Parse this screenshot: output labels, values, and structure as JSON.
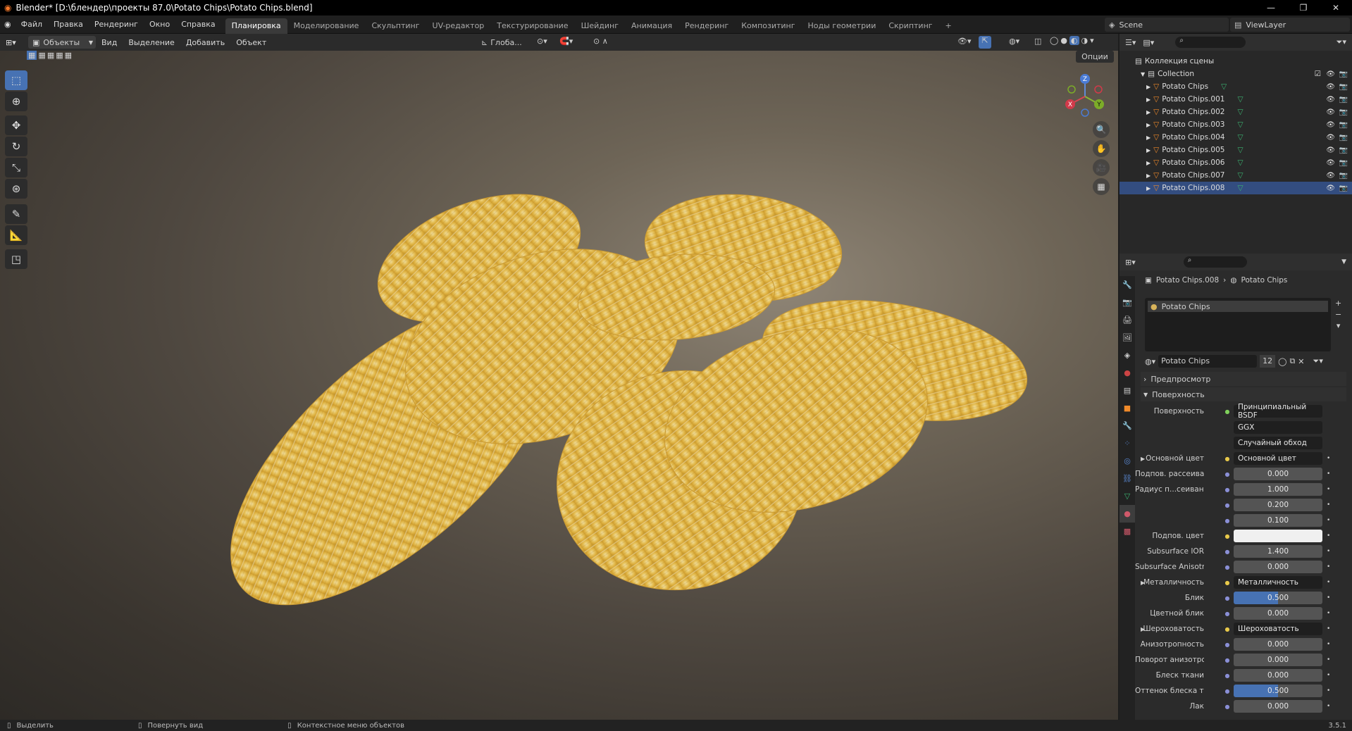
{
  "window": {
    "title": "Blender* [D:\\блендер\\проекты 87.0\\Potato Chips\\Potato Chips.blend]"
  },
  "menu": {
    "items": [
      "Файл",
      "Правка",
      "Рендеринг",
      "Окно",
      "Справка"
    ]
  },
  "workspaces": {
    "tabs": [
      "Планировка",
      "Моделирование",
      "Скульптинг",
      "UV-редактор",
      "Текстурирование",
      "Шейдинг",
      "Анимация",
      "Рендеринг",
      "Композитинг",
      "Ноды геометрии",
      "Скриптинг"
    ],
    "active": "Планировка",
    "plus": "+"
  },
  "scene": {
    "label": "Scene",
    "view_layer": "ViewLayer"
  },
  "viewport_header": {
    "mode": "Объекты",
    "menus": [
      "Вид",
      "Выделение",
      "Добавить",
      "Объект"
    ],
    "transform": "Глоба...",
    "options": "Опции"
  },
  "gizmo": {
    "x": "X",
    "y": "Y",
    "z": "Z"
  },
  "outliner": {
    "root": "Коллекция сцены",
    "collection": "Collection",
    "objects": [
      "Potato Chips",
      "Potato Chips.001",
      "Potato Chips.002",
      "Potato Chips.003",
      "Potato Chips.004",
      "Potato Chips.005",
      "Potato Chips.006",
      "Potato Chips.007",
      "Potato Chips.008"
    ],
    "selected": "Potato Chips.008"
  },
  "properties": {
    "breadcrumb_object": "Potato Chips.008",
    "breadcrumb_material": "Potato Chips",
    "slot": "Potato Chips",
    "material_name": "Potato Chips",
    "users": "12",
    "preview": "Предпросмотр",
    "surface_section": "Поверхность",
    "surface_label": "Поверхность",
    "surface_value": "Принципиальный BSDF",
    "distribution": "GGX",
    "subsurface_method": "Случайный обход",
    "rows": [
      {
        "label": "Основной цвет",
        "value": "Основной цвет",
        "type": "link"
      },
      {
        "label": "Подпов. рассеива...",
        "value": "0.000",
        "type": "num"
      },
      {
        "label": "Радиус п...сеивания",
        "value": "1.000",
        "type": "num"
      },
      {
        "label": "",
        "value": "0.200",
        "type": "num"
      },
      {
        "label": "",
        "value": "0.100",
        "type": "num"
      },
      {
        "label": "Подпов. цвет",
        "value": "",
        "type": "color"
      },
      {
        "label": "Subsurface IOR",
        "value": "1.400",
        "type": "num"
      },
      {
        "label": "Subsurface Anisotr...",
        "value": "0.000",
        "type": "num"
      },
      {
        "label": "Металличность",
        "value": "Металличность",
        "type": "link"
      },
      {
        "label": "Блик",
        "value": "0.500",
        "type": "bar"
      },
      {
        "label": "Цветной блик",
        "value": "0.000",
        "type": "num"
      },
      {
        "label": "Шероховатость",
        "value": "Шероховатость",
        "type": "link"
      },
      {
        "label": "Анизотропность",
        "value": "0.000",
        "type": "num"
      },
      {
        "label": "Поворот анизотро...",
        "value": "0.000",
        "type": "num"
      },
      {
        "label": "Блеск ткани",
        "value": "0.000",
        "type": "num"
      },
      {
        "label": "Оттенок блеска тк...",
        "value": "0.500",
        "type": "bar"
      },
      {
        "label": "Лак",
        "value": "0.000",
        "type": "num"
      }
    ]
  },
  "status": {
    "select": "Выделить",
    "rotate": "Повернуть вид",
    "context": "Контекстное меню объектов",
    "version": "3.5.1"
  }
}
